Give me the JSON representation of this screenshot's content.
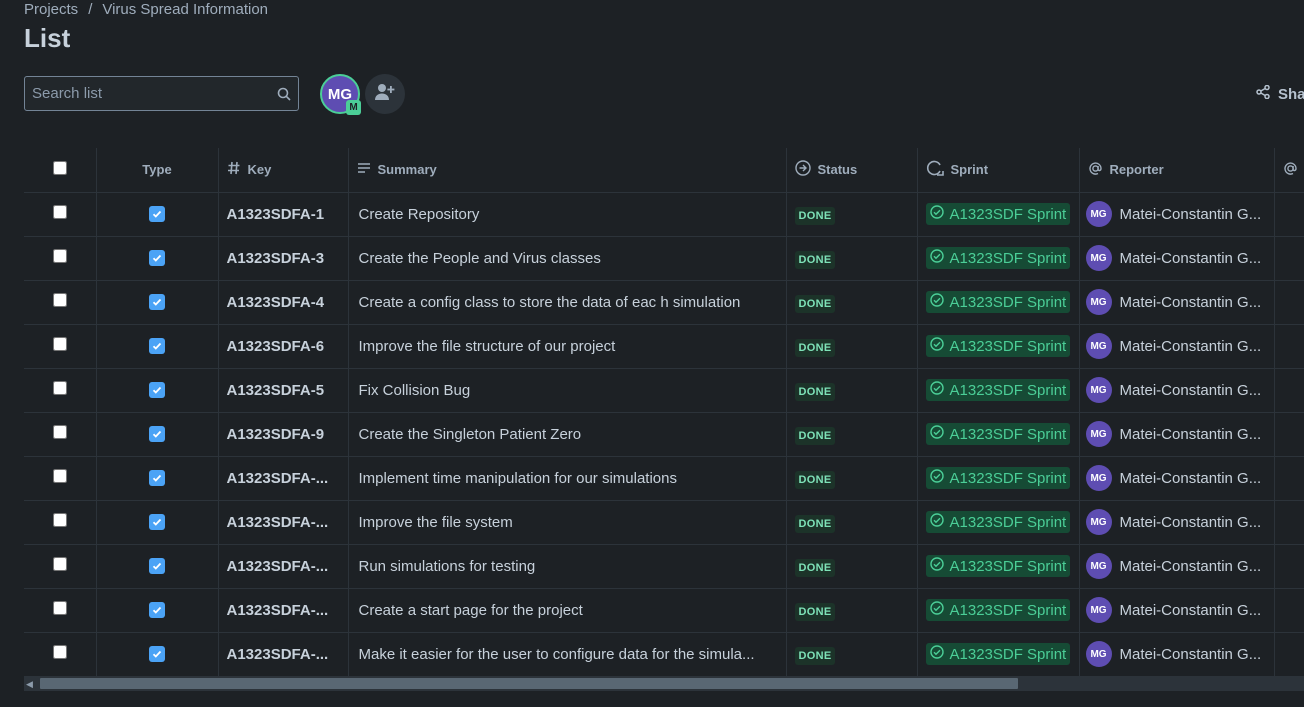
{
  "breadcrumb": {
    "root": "Projects",
    "sep": "/",
    "project": "Virus Spread Information"
  },
  "page": {
    "title": "List"
  },
  "search": {
    "placeholder": "Search list",
    "icon": "search-icon"
  },
  "avatar": {
    "initials": "MG",
    "badge": "M"
  },
  "toolbar": {
    "share_label": "Share"
  },
  "table": {
    "headers": {
      "type": "Type",
      "key": "Key",
      "summary": "Summary",
      "status": "Status",
      "sprint": "Sprint",
      "reporter": "Reporter"
    },
    "rows": [
      {
        "key": "A1323SDFA-1",
        "summary": "Create Repository",
        "status": "DONE",
        "sprint": "A1323SDF Sprint",
        "reporter_initials": "MG",
        "reporter": "Matei-Constantin G..."
      },
      {
        "key": "A1323SDFA-3",
        "summary": "Create the People and Virus classes",
        "status": "DONE",
        "sprint": "A1323SDF Sprint",
        "reporter_initials": "MG",
        "reporter": "Matei-Constantin G..."
      },
      {
        "key": "A1323SDFA-4",
        "summary": "Create a config class to store the data of eac h simulation",
        "status": "DONE",
        "sprint": "A1323SDF Sprint",
        "reporter_initials": "MG",
        "reporter": "Matei-Constantin G..."
      },
      {
        "key": "A1323SDFA-6",
        "summary": "Improve the file structure of our project",
        "status": "DONE",
        "sprint": "A1323SDF Sprint",
        "reporter_initials": "MG",
        "reporter": "Matei-Constantin G..."
      },
      {
        "key": "A1323SDFA-5",
        "summary": "Fix Collision Bug",
        "status": "DONE",
        "sprint": "A1323SDF Sprint",
        "reporter_initials": "MG",
        "reporter": "Matei-Constantin G..."
      },
      {
        "key": "A1323SDFA-9",
        "summary": "Create the Singleton Patient Zero",
        "status": "DONE",
        "sprint": "A1323SDF Sprint",
        "reporter_initials": "MG",
        "reporter": "Matei-Constantin G..."
      },
      {
        "key": "A1323SDFA-...",
        "summary": "Implement time manipulation for our simulations",
        "status": "DONE",
        "sprint": "A1323SDF Sprint",
        "reporter_initials": "MG",
        "reporter": "Matei-Constantin G..."
      },
      {
        "key": "A1323SDFA-...",
        "summary": "Improve the file system",
        "status": "DONE",
        "sprint": "A1323SDF Sprint",
        "reporter_initials": "MG",
        "reporter": "Matei-Constantin G..."
      },
      {
        "key": "A1323SDFA-...",
        "summary": "Run simulations for testing",
        "status": "DONE",
        "sprint": "A1323SDF Sprint",
        "reporter_initials": "MG",
        "reporter": "Matei-Constantin G..."
      },
      {
        "key": "A1323SDFA-...",
        "summary": "Create a start page for the project",
        "status": "DONE",
        "sprint": "A1323SDF Sprint",
        "reporter_initials": "MG",
        "reporter": "Matei-Constantin G..."
      },
      {
        "key": "A1323SDFA-...",
        "summary": "Make it easier for the user to configure data for the simula...",
        "status": "DONE",
        "sprint": "A1323SDF Sprint",
        "reporter_initials": "MG",
        "reporter": "Matei-Constantin G..."
      }
    ]
  },
  "colors": {
    "background": "#1d2125",
    "done_text": "#7ee2b8",
    "sprint_bg": "#164b35",
    "sprint_text": "#4bce97",
    "avatar_bg": "#5e4db2",
    "checkbox": "#579dff"
  }
}
